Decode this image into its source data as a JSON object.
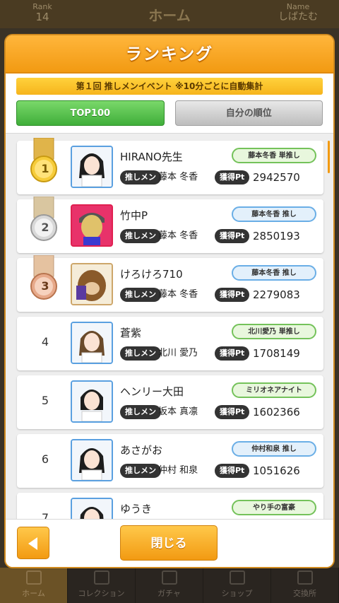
{
  "background": {
    "rank_label": "Rank",
    "rank_value": "14",
    "title": "ホーム",
    "name_label": "Name",
    "name_value": "しばたむ",
    "nav": [
      {
        "label": "ホーム",
        "icon": "home-icon",
        "active": true
      },
      {
        "label": "コレクション",
        "icon": "collection-icon",
        "active": false
      },
      {
        "label": "ガチャ",
        "icon": "gacha-icon",
        "active": false
      },
      {
        "label": "ショップ",
        "icon": "cart-icon",
        "active": false
      },
      {
        "label": "交換所",
        "icon": "exchange-icon",
        "active": false
      }
    ]
  },
  "modal": {
    "title": "ランキング",
    "event": "第１回 推しメンイベント ※10分ごとに自動集計",
    "tabs": {
      "top": "TOP100",
      "mine": "自分の順位"
    },
    "push_label": "推しメン",
    "pt_label": "獲得Pt",
    "close": "閉じる"
  },
  "rows": [
    {
      "rank": "1",
      "name": "HIRANO先生",
      "member": "藤本 冬香",
      "pt": "2942570",
      "tag": "藤本冬香 単推し",
      "tag_color": "green",
      "medal": "gold"
    },
    {
      "rank": "2",
      "name": "竹中P",
      "member": "藤本 冬香",
      "pt": "2850193",
      "tag": "藤本冬香 推し",
      "tag_color": "blue",
      "medal": "silver"
    },
    {
      "rank": "3",
      "name": "けろけろ710",
      "member": "藤本 冬香",
      "pt": "2279083",
      "tag": "藤本冬香 推し",
      "tag_color": "blue",
      "medal": "bronze"
    },
    {
      "rank": "4",
      "name": "蒼紫",
      "member": "北川 愛乃",
      "pt": "1708149",
      "tag": "北川愛乃 単推し",
      "tag_color": "green",
      "medal": ""
    },
    {
      "rank": "5",
      "name": "ヘンリー大田",
      "member": "坂本 真凛",
      "pt": "1602366",
      "tag": "ミリオネアナイト",
      "tag_color": "green",
      "medal": ""
    },
    {
      "rank": "6",
      "name": "あさがお",
      "member": "仲村 和泉",
      "pt": "1051626",
      "tag": "仲村和泉 推し",
      "tag_color": "blue",
      "medal": ""
    },
    {
      "rank": "7",
      "name": "ゆうき",
      "member": "",
      "pt": "",
      "tag": "やり手の富豪",
      "tag_color": "green",
      "medal": ""
    }
  ],
  "colors": {
    "accent": "#f29a12",
    "green": "#3fae3a",
    "blue": "#6aaee6"
  }
}
